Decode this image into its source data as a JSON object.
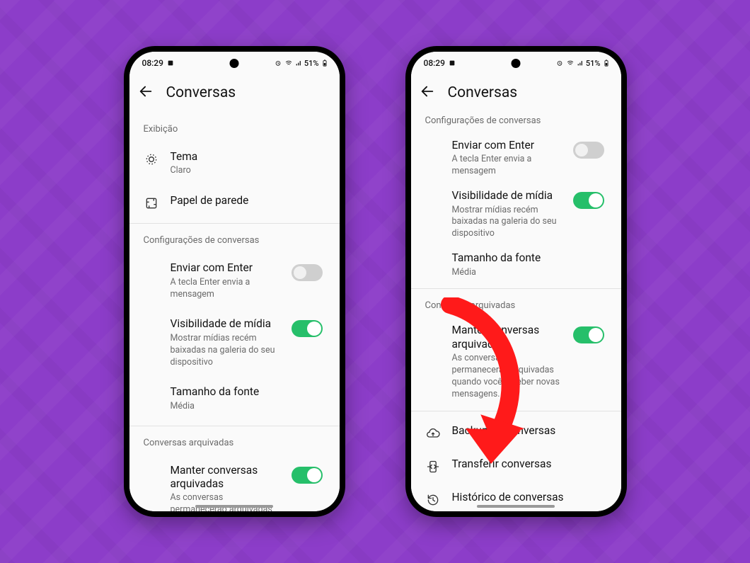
{
  "status": {
    "time": "08:29",
    "battery": "51%"
  },
  "header": {
    "title": "Conversas"
  },
  "phone1": {
    "sections": {
      "display_header": "Exibição",
      "theme": {
        "title": "Tema",
        "subtitle": "Claro"
      },
      "wallpaper": {
        "title": "Papel de parede"
      },
      "chat_settings_header": "Configurações de conversas",
      "enter": {
        "title": "Enviar com Enter",
        "subtitle": "A tecla Enter envia a mensagem"
      },
      "media": {
        "title": "Visibilidade de mídia",
        "subtitle": "Mostrar mídias recém baixadas na galeria do seu dispositivo"
      },
      "font": {
        "title": "Tamanho da fonte",
        "subtitle": "Média"
      },
      "archived_header": "Conversas arquivadas",
      "keep": {
        "title": "Manter conversas arquivadas",
        "subtitle": "As conversas permanecerão arquivadas quando você receber"
      }
    }
  },
  "phone2": {
    "sections": {
      "chat_settings_header": "Configurações de conversas",
      "enter": {
        "title": "Enviar com Enter",
        "subtitle": "A tecla Enter envia a mensagem"
      },
      "media": {
        "title": "Visibilidade de mídia",
        "subtitle": "Mostrar mídias recém baixadas na galeria do seu dispositivo"
      },
      "font": {
        "title": "Tamanho da fonte",
        "subtitle": "Média"
      },
      "archived_header": "Conversas arquivadas",
      "keep": {
        "title": "Manter conversas arquivadas",
        "subtitle": "As conversas permanecerão arquivadas quando você receber novas mensagens."
      },
      "backup": {
        "title": "Backup de conversas"
      },
      "transfer": {
        "title": "Transferir conversas"
      },
      "history": {
        "title": "Histórico de conversas"
      }
    }
  }
}
